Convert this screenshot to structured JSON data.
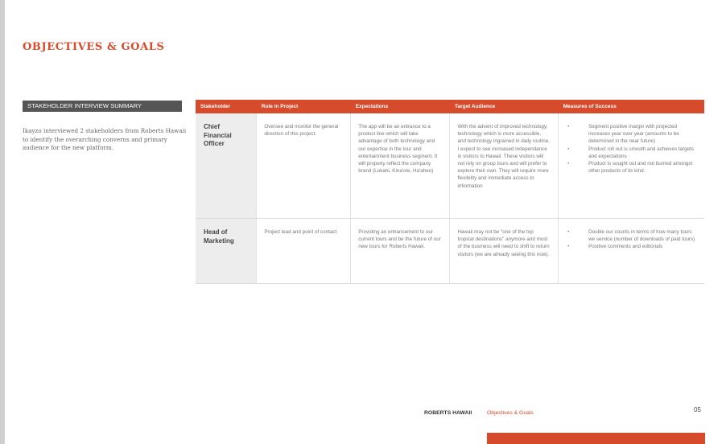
{
  "page": {
    "title": "OBJECTIVES & GOALS",
    "summary_badge": "STAKEHOLDER INTERVIEW SUMMARY",
    "summary_text": "Ikayzo interviewed 2 stakeholders from Roberts Hawaii to identify the overarching converns and primary audience for the new platform.",
    "accent_color": "#d64b2c"
  },
  "table": {
    "headers": [
      "Stakeholder",
      "Role in Project",
      "Expectations",
      "Target Audience",
      "Measures of Success"
    ],
    "rows": [
      {
        "stakeholder": "Chief Financial Officer",
        "role": "Oversee and monitor the general direction of this project.",
        "expectations": "The app will be an entrance to a product line which will take advantage of both technology and our expertise in the tour and entertainment business segment. It will properly reflect the company brand (Lokahi, Kina'ole, Ha'aheo)",
        "audience": "With the advent of improved technology, technology which is more accessible, and technology ingrained in daily routine, I expect to see increased independance in visitors to Hawaii. These visitors will not rely on group tours and will prefer to explore their own. They will require more flexibility and immediate access to information",
        "measures": [
          "Segment positive margin with projected increases year over year (amounts to be determined in the near future)",
          "Product roll out is smooth and achieves targets and expectations",
          "Product is sought out and not burried amongst other products of its kind."
        ]
      },
      {
        "stakeholder": "Head of Marketing",
        "role": "Project lead and point of contact",
        "expectations": "Providing an enhancement to our current tours and be the future of our new tours for Roberts Hawaii.",
        "audience": "Hawaii may not be \"one of the top tropical destinations\" anymore and most of the business will need to shift to return visitors (we are already seeing this now).",
        "measures": [
          "Double our counts in terms of how many tours we service (number of downloads of paid tours)",
          "Positive comments and editorials"
        ]
      }
    ]
  },
  "footer": {
    "brand": "ROBERTS HAWAII",
    "section": "Objectives & Goals",
    "page_number": "05"
  }
}
